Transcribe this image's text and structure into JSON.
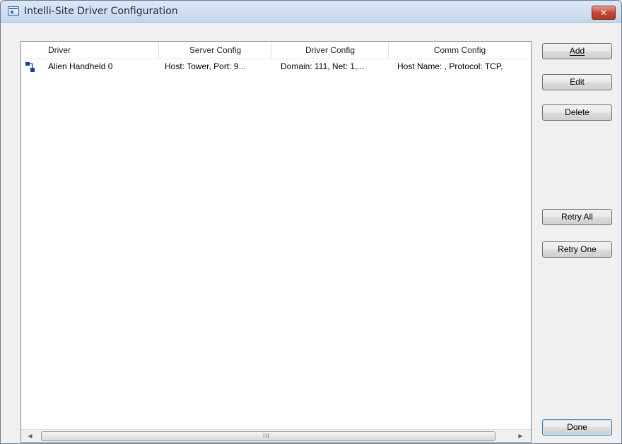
{
  "window": {
    "title": "Intelli-Site Driver Configuration",
    "close_label": "✕"
  },
  "list": {
    "columns": [
      "Driver",
      "Server Config",
      "Driver Config",
      "Comm Config"
    ],
    "rows": [
      {
        "icon": "network-driver-icon",
        "driver": "Alien Handheld 0",
        "server_config": "Host: Tower, Port: 9...",
        "driver_config": "Domain: 111, Net: 1,...",
        "comm_config": "Host Name: , Protocol: TCP,"
      }
    ],
    "scrollbar_grip": "III"
  },
  "buttons": {
    "add": "Add",
    "edit": "Edit",
    "delete": "Delete",
    "retry_all": "Retry All",
    "retry_one": "Retry One",
    "done": "Done"
  },
  "colors": {
    "close_button": "#c8452f",
    "titlebar": "#c4d6ee",
    "icon_blue": "#1040c0"
  }
}
